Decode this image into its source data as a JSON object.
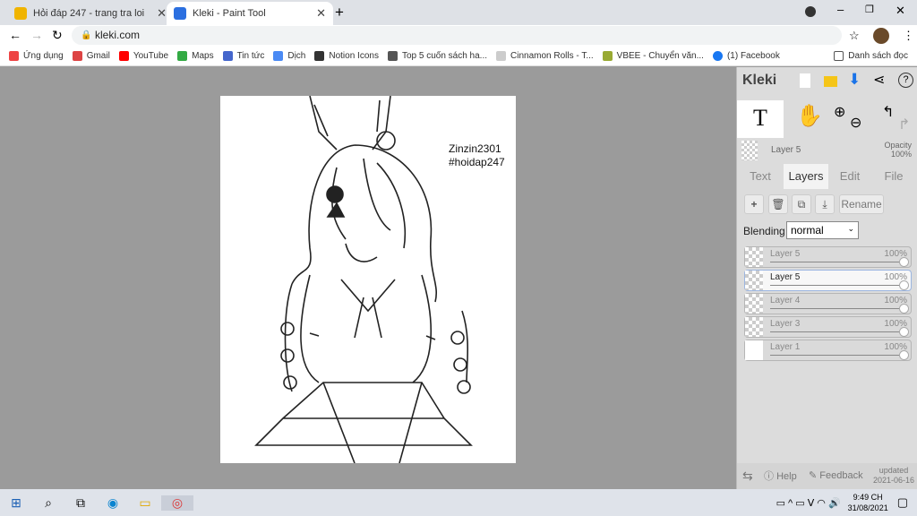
{
  "browser": {
    "tabs": [
      {
        "title": "Hỏi đáp 247 - trang tra loi",
        "active": false,
        "favicon_color": "#f0b400"
      },
      {
        "title": "Kleki - Paint Tool",
        "active": true,
        "favicon_color": "#2b6fe0"
      }
    ],
    "new_tab": "+",
    "url": "kleki.com",
    "bookmarks": [
      {
        "label": "Ứng dụng",
        "color": "#e44"
      },
      {
        "label": "Gmail",
        "color": "#d44"
      },
      {
        "label": "YouTube",
        "color": "#f00"
      },
      {
        "label": "Maps",
        "color": "#3a4"
      },
      {
        "label": "Tin tức",
        "color": "#46c"
      },
      {
        "label": "Dịch",
        "color": "#4a8af4"
      },
      {
        "label": "Notion Icons",
        "color": "#333"
      },
      {
        "label": "Top 5 cuốn sách ha...",
        "color": "#555"
      },
      {
        "label": "Cinnamon Rolls - T...",
        "color": "#ccc"
      },
      {
        "label": "VBEE - Chuyển văn...",
        "color": "#9a3"
      },
      {
        "label": "(1) Facebook",
        "color": "#1877f2"
      }
    ],
    "reading_list": "Danh sách đọc"
  },
  "canvas": {
    "signature": "Zinzin2301",
    "tag": "#hoidap247"
  },
  "panel": {
    "logo": "Kleki",
    "current_layer": "Layer 5",
    "opacity_label": "Opacity",
    "opacity_value": "100%",
    "tabs": [
      "Text",
      "Layers",
      "Edit",
      "File"
    ],
    "active_tab": "Layers",
    "rename": "Rename",
    "blending_label": "Blending",
    "blending_value": "normal",
    "layers": [
      {
        "name": "Layer 5",
        "opacity": "100%",
        "selected": false
      },
      {
        "name": "Layer 5",
        "opacity": "100%",
        "selected": true
      },
      {
        "name": "Layer 4",
        "opacity": "100%",
        "selected": false
      },
      {
        "name": "Layer 3",
        "opacity": "100%",
        "selected": false
      },
      {
        "name": "Layer 1",
        "opacity": "100%",
        "selected": false
      }
    ],
    "help": "Help",
    "feedback": "Feedback",
    "updated": "updated",
    "updated_date": "2021-06-16"
  },
  "taskbar": {
    "time": "9:49 CH",
    "date": "31/08/2021"
  }
}
